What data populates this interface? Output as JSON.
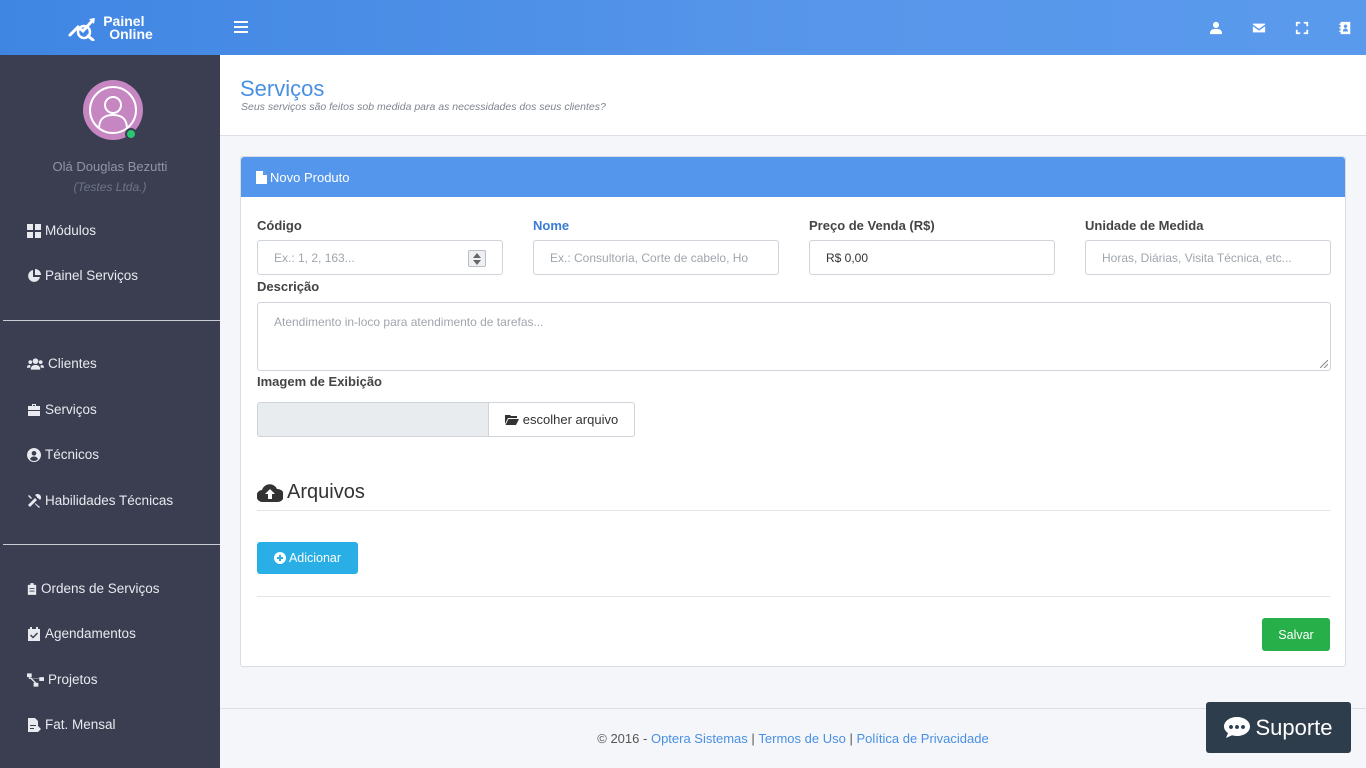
{
  "brand": {
    "line1": "Painel",
    "line2": "Online"
  },
  "topbar": {
    "icons": [
      "user-icon",
      "envelope-icon",
      "fullscreen-icon",
      "contact-book-icon"
    ]
  },
  "sidebar": {
    "greeting": "Olá Douglas Bezutti",
    "company": "(Testes Ltda.)",
    "items": [
      {
        "label": "Módulos",
        "icon": "grid-icon"
      },
      {
        "label": "Painel Serviços",
        "icon": "pie-chart-icon"
      },
      {
        "label": "Clientes",
        "icon": "users-icon"
      },
      {
        "label": "Serviços",
        "icon": "briefcase-icon"
      },
      {
        "label": "Técnicos",
        "icon": "user-circle-icon"
      },
      {
        "label": "Habilidades Técnicas",
        "icon": "tools-icon"
      },
      {
        "label": "Ordens de Serviços",
        "icon": "clipboard-icon"
      },
      {
        "label": "Agendamentos",
        "icon": "calendar-check-icon"
      },
      {
        "label": "Projetos",
        "icon": "sitemap-icon"
      },
      {
        "label": "Fat. Mensal",
        "icon": "file-invoice-icon"
      }
    ]
  },
  "page": {
    "title": "Serviços",
    "subtitle": "Seus serviços são feitos sob medida para as necessidades dos seus clientes?"
  },
  "card": {
    "title": "Novo Produto"
  },
  "form": {
    "codigo": {
      "label": "Código",
      "placeholder": "Ex.: 1, 2, 163..."
    },
    "nome": {
      "label": "Nome",
      "placeholder": "Ex.: Consultoria, Corte de cabelo, Ho"
    },
    "preco": {
      "label": "Preço de Venda (R$)",
      "value": "R$ 0,00"
    },
    "unidade": {
      "label": "Unidade de Medida",
      "placeholder": "Horas, Diárias, Visita Técnica, etc..."
    },
    "descricao": {
      "label": "Descrição",
      "placeholder": "Atendimento in-loco para atendimento de tarefas..."
    },
    "imagem": {
      "label": "Imagem de Exibição",
      "button": "escolher arquivo"
    }
  },
  "arquivos": {
    "title": "Arquivos",
    "add_button": "Adicionar"
  },
  "save_button": "Salvar",
  "footer": {
    "copyright": "© 2016 -",
    "company": "Optera Sistemas",
    "sep": "|",
    "terms": "Termos de Uso",
    "privacy": "Política de Privacidade"
  },
  "support": {
    "label": "Suporte"
  }
}
